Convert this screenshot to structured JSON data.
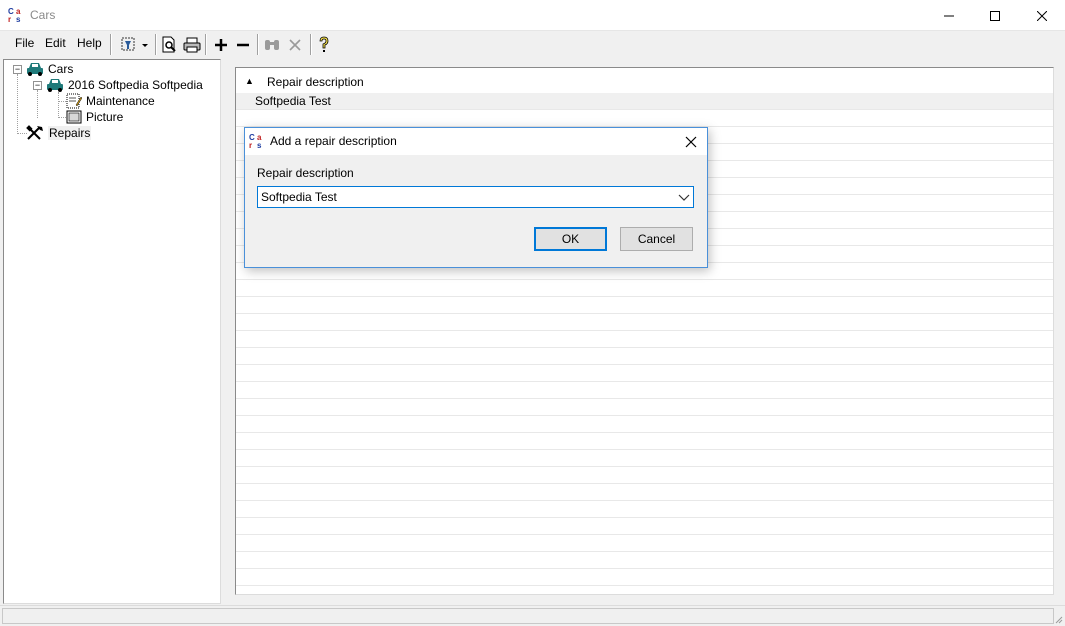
{
  "window": {
    "title": "Cars"
  },
  "menu": {
    "file": "File",
    "edit": "Edit",
    "help": "Help"
  },
  "toolbar": {
    "icons": [
      "filter-icon",
      "preview-icon",
      "print-icon",
      "add-icon",
      "remove-icon",
      "find-icon",
      "delete-icon",
      "help-icon"
    ]
  },
  "tree": {
    "root": "Cars",
    "car": "2016 Softpedia Softpedia",
    "maintenance": "Maintenance",
    "picture": "Picture",
    "repairs": "Repairs"
  },
  "grid": {
    "column": "Repair description",
    "sort_indicator": "▲",
    "rows": [
      "Softpedia Test"
    ]
  },
  "dialog": {
    "title": "Add a repair description",
    "field_label": "Repair description",
    "field_value": "Softpedia Test",
    "ok": "OK",
    "cancel": "Cancel"
  },
  "colors": {
    "accent": "#0078d7",
    "car_icon": "#1f7a7a"
  }
}
